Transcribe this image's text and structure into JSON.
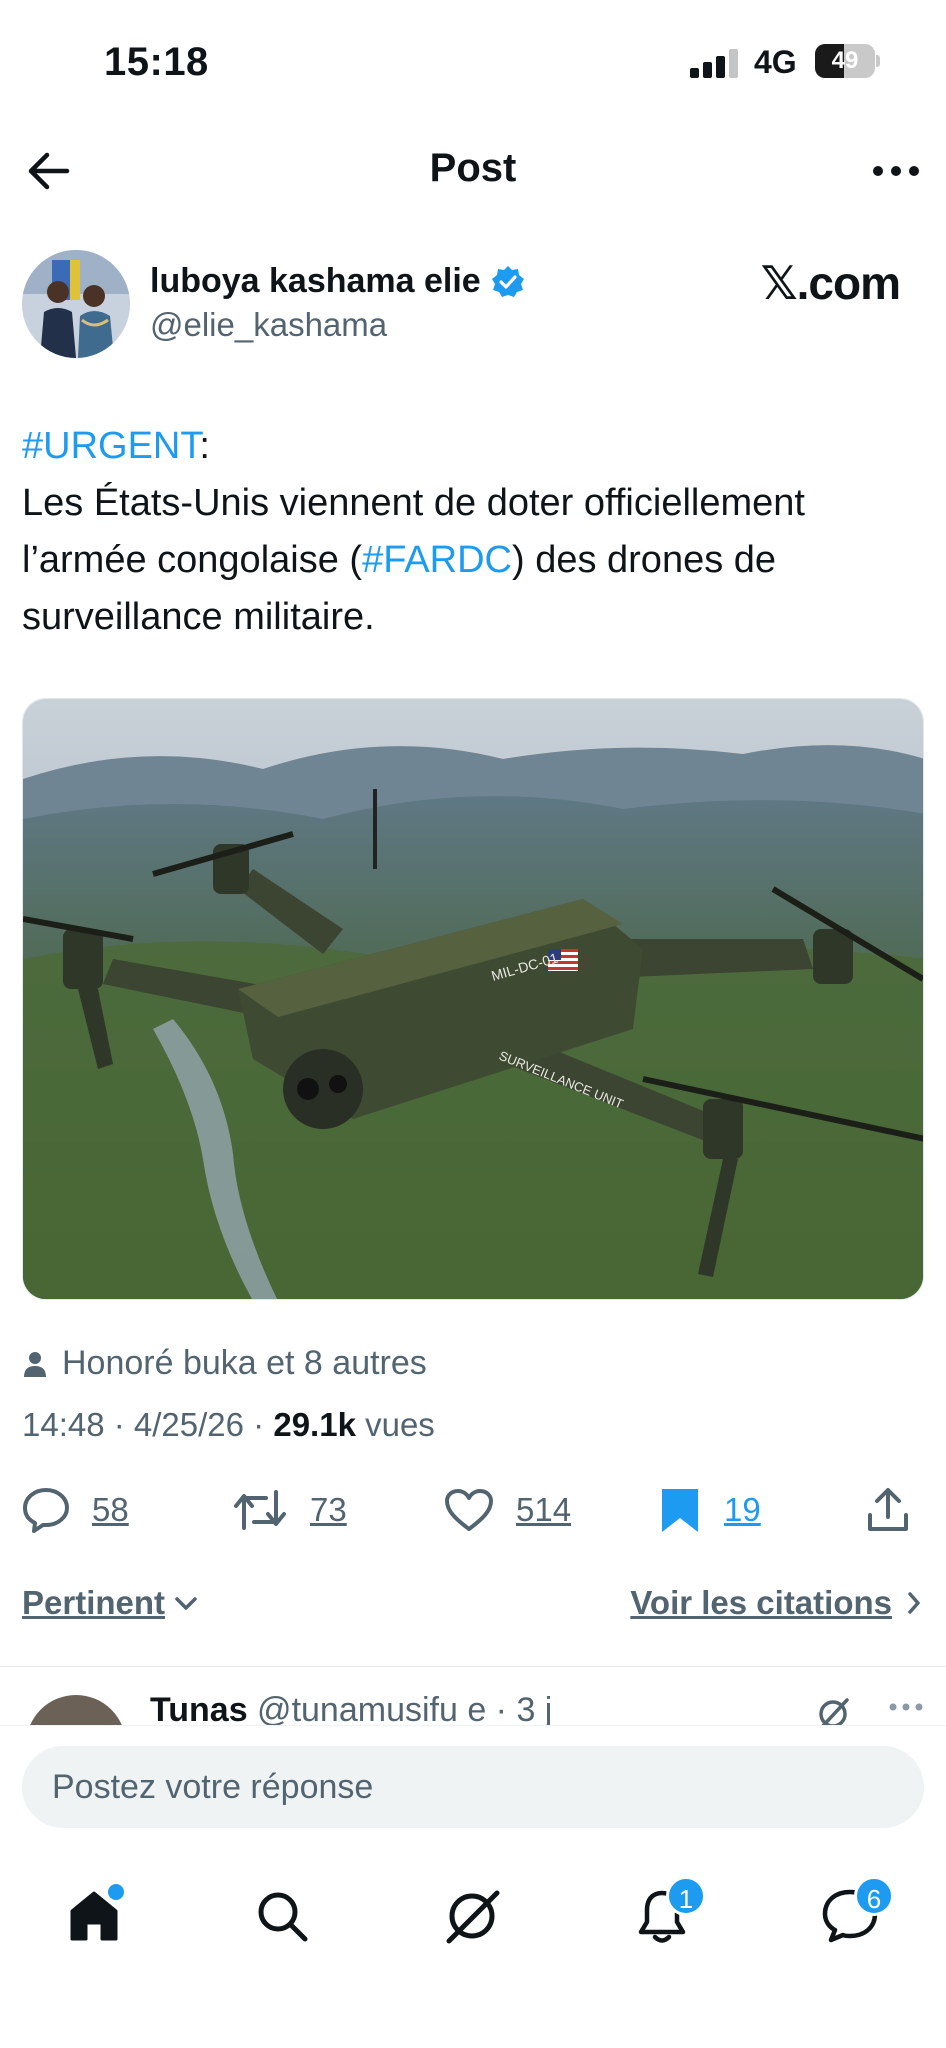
{
  "status_bar": {
    "time": "15:18",
    "network": "4G",
    "battery": "49",
    "battery_level": 0.49
  },
  "header": {
    "title": "Post"
  },
  "author": {
    "display_name": "luboya kashama elie",
    "handle": "@elie_kashama",
    "verified": true,
    "source_logo": "𝕏.com"
  },
  "tweet": {
    "hashtag_urgent": "#URGENT",
    "after_urgent": ":",
    "line1": "Les États-Unis viennent de doter officiellement",
    "line2_pre": "l’armée congolaise (",
    "hashtag_fardc": "#FARDC",
    "line2_post": ") des drones de",
    "line3": "surveillance militaire.",
    "image_labels": {
      "tail": "MIL-DC-01",
      "arm": "SURVEILLANCE UNIT"
    }
  },
  "meta": {
    "likers": "Honoré buka et 8 autres",
    "time_date": "14:48 · 4/25/26 · ",
    "views_count": "29.1k",
    "views_label": " vues"
  },
  "actions": {
    "replies": "58",
    "reposts": "73",
    "likes": "514",
    "bookmarks": "19"
  },
  "sort": {
    "label": "Pertinent",
    "quotes": "Voir les citations"
  },
  "reply_preview": {
    "name": "Tunas",
    "meta": " @tunamusifu e · 3 j"
  },
  "reply_box": {
    "placeholder": "Postez votre réponse"
  },
  "tabbar": {
    "notifications_badge": "1",
    "messages_badge": "6"
  },
  "colors": {
    "accent": "#1d9bf0",
    "text": "#0f1419",
    "secondary": "#536471"
  },
  "icons": [
    "back-arrow-icon",
    "more-icon",
    "verified-icon",
    "person-icon",
    "reply-icon",
    "repost-icon",
    "like-icon",
    "bookmark-icon",
    "share-icon",
    "chevron-down-icon",
    "chevron-right-icon",
    "grok-icon",
    "home-icon",
    "search-icon",
    "notifications-icon",
    "messages-icon"
  ]
}
